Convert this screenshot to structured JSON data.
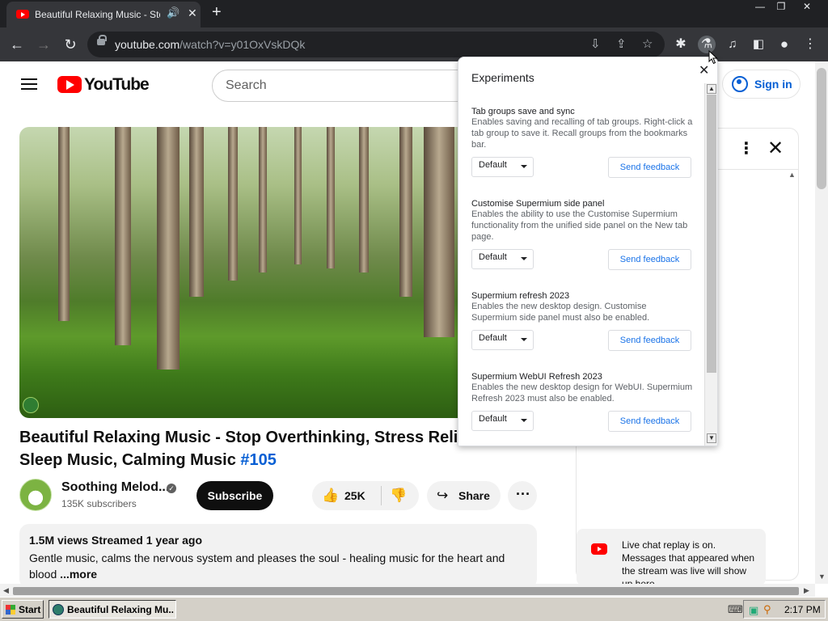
{
  "browser": {
    "tab_title": "Beautiful Relaxing Music - Stop",
    "audio_icon": "speaker-icon",
    "tab_close": "✕",
    "new_tab": "+",
    "window_controls": {
      "minimize": "—",
      "restore": "❐",
      "close": "✕"
    },
    "url_host": "youtube.com",
    "url_path": "/watch?v=y01OxVskDQk"
  },
  "youtube": {
    "logo_text": "YouTube",
    "search_placeholder": "Search",
    "sign_in": "Sign in",
    "video_title": "Beautiful Relaxing Music - Stop Overthinking, Stress Relief M",
    "video_title_line2": "Sleep Music, Calming Music ",
    "video_hashtag": "#105",
    "channel_name": "Soothing Melod...",
    "subscribers": "135K subscribers",
    "subscribe": "Subscribe",
    "likes": "25K",
    "share": "Share",
    "description_stats": "1.5M views  Streamed 1 year ago",
    "description_text": "Gentle music, calms the nervous system and pleases the soul - healing music for the heart and blood ",
    "description_more": "...more",
    "live_chat_replay": "Live chat replay is on. Messages that appeared when the stream was live will show up here."
  },
  "experiments": {
    "title": "Experiments",
    "close": "✕",
    "features": [
      {
        "name": "Tab groups save and sync",
        "description": "Enables saving and recalling of tab groups. Right-click a tab group to save it. Recall groups from the bookmarks bar.",
        "value": "Default",
        "feedback": "Send feedback"
      },
      {
        "name": "Customise Supermium side panel",
        "description": "Enables the ability to use the Customise Supermium functionality from the unified side panel on the New tab page.",
        "value": "Default",
        "feedback": "Send feedback"
      },
      {
        "name": "Supermium refresh 2023",
        "description": "Enables the new desktop design. Customise Supermium side panel must also be enabled.",
        "value": "Default",
        "feedback": "Send feedback"
      },
      {
        "name": "Supermium WebUI Refresh 2023",
        "description": "Enables the new desktop design for WebUI. Supermium Refresh 2023 must also be enabled.",
        "value": "Default",
        "feedback": "Send feedback"
      }
    ]
  },
  "taskbar": {
    "start": "Start",
    "task_title": "Beautiful Relaxing Mu...",
    "clock": "2:17 PM"
  }
}
